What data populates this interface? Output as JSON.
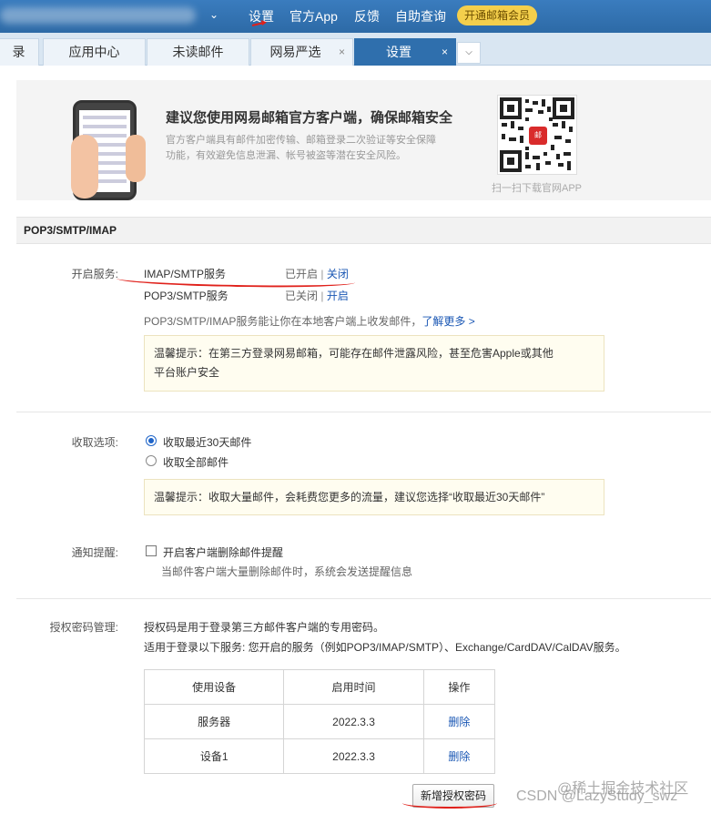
{
  "topbar": {
    "links": [
      "设置",
      "官方App",
      "反馈",
      "自助查询"
    ],
    "vip": "开通邮箱会员"
  },
  "tabs": [
    {
      "label": "录"
    },
    {
      "label": "应用中心"
    },
    {
      "label": "未读邮件"
    },
    {
      "label": "网易严选",
      "close": "×"
    },
    {
      "label": "设置",
      "close": "×",
      "active": true
    }
  ],
  "banner": {
    "title": "建议您使用网易邮箱官方客户端，确保邮箱安全",
    "desc": "官方客户端具有邮件加密传输、邮箱登录二次验证等安全保障功能，有效避免信息泄漏、帐号被盗等潜在安全风险。",
    "qr_logo": "邮",
    "qr_caption": "扫一扫下载官网APP"
  },
  "section_title": "POP3/SMTP/IMAP",
  "services": {
    "label": "开启服务:",
    "items": [
      {
        "name": "IMAP/SMTP服务",
        "status": "已开启",
        "sep": "|",
        "action": "关闭"
      },
      {
        "name": "POP3/SMTP服务",
        "status": "已关闭",
        "sep": "|",
        "action": "开启"
      }
    ],
    "note": "POP3/SMTP/IMAP服务能让你在本地客户端上收发邮件，",
    "note_link": "了解更多 >",
    "tip_line1": "温馨提示：在第三方登录网易邮箱，可能存在邮件泄露风险，甚至危害Apple或其他",
    "tip_line2": "平台账户安全"
  },
  "receive": {
    "label": "收取选项:",
    "options": [
      {
        "label": "收取最近30天邮件",
        "selected": true
      },
      {
        "label": "收取全部邮件",
        "selected": false
      }
    ],
    "tip": "温馨提示：收取大量邮件，会耗费您更多的流量，建议您选择“收取最近30天邮件”"
  },
  "notify": {
    "label": "通知提醒:",
    "checkbox_label": "开启客户端删除邮件提醒",
    "checked": false,
    "desc": "当邮件客户端大量删除邮件时，系统会发送提醒信息"
  },
  "auth": {
    "label": "授权密码管理:",
    "line1": "授权码是用于登录第三方邮件客户端的专用密码。",
    "line2": "适用于登录以下服务: 您开启的服务（例如POP3/IMAP/SMTP）、Exchange/CardDAV/CalDAV服务。",
    "table": {
      "headers": [
        "使用设备",
        "启用时间",
        "操作"
      ],
      "rows": [
        {
          "device": "服务器",
          "date": "2022.3.3",
          "action": "删除"
        },
        {
          "device": "设备1",
          "date": "2022.3.3",
          "action": "删除"
        }
      ]
    },
    "add_button": "新增授权密码"
  },
  "watermark": {
    "line1": "@稀土掘金技术社区",
    "line2": "CSDN @LazyStudy_swz"
  },
  "colors": {
    "accent": "#2f6fad",
    "link": "#1a57b4",
    "annotation": "#e0211b",
    "vip": "#f4cf4c"
  }
}
